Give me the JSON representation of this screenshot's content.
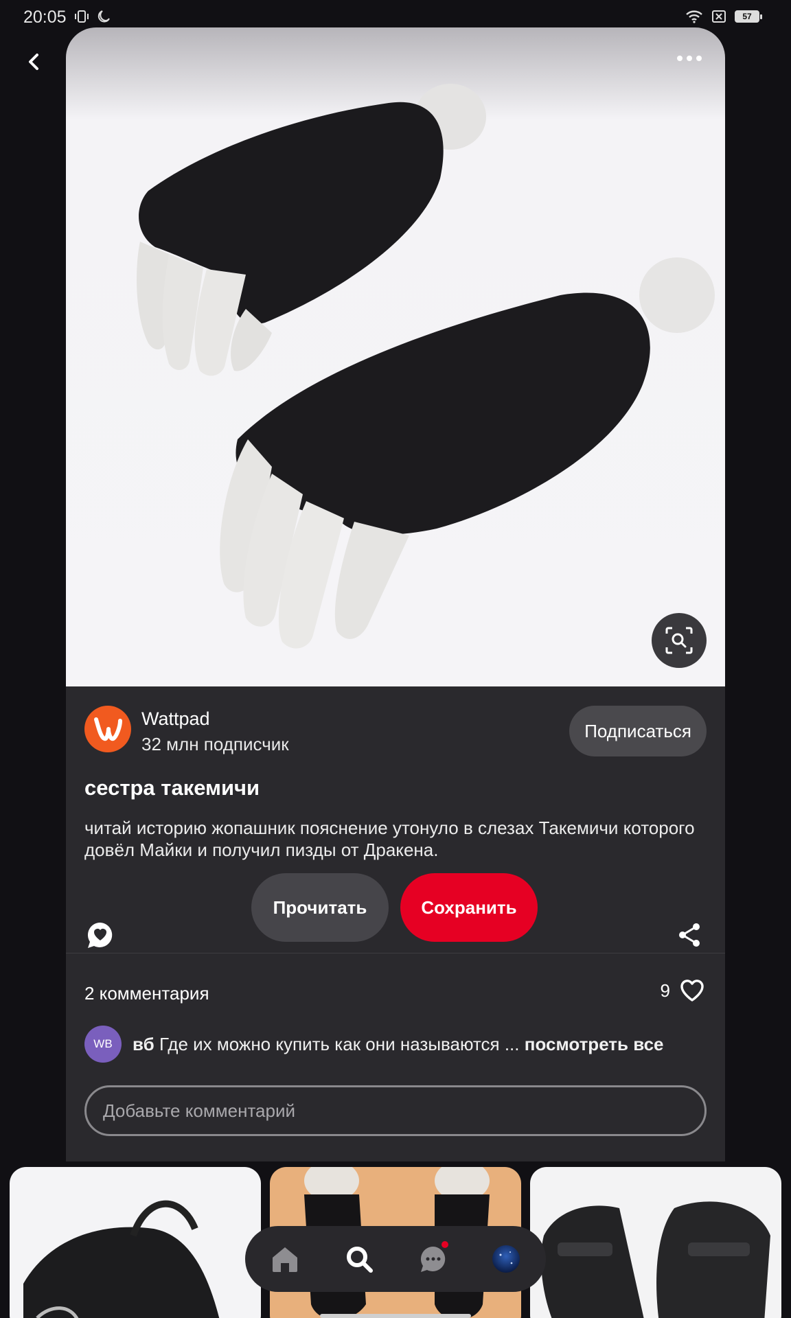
{
  "status_bar": {
    "time": "20:05",
    "battery": "57",
    "icons": [
      "vibrate-icon",
      "moon-icon",
      "wifi-icon",
      "sim-x-icon",
      "battery-icon"
    ]
  },
  "navigation": {
    "back_icon": "chevron-left-icon",
    "more_icon": "more-horizontal-icon"
  },
  "author": {
    "name": "Wattpad",
    "followers": "32 млн подписчик",
    "follow_label": "Подписаться",
    "avatar_letter": "w",
    "brand_color": "#f15a1f"
  },
  "pin": {
    "title": "сестра такемичи",
    "description": "читай историю жопашник пояснение утонуло в слезах Такемичи которого довёл Майки и получил пизды от Дракена."
  },
  "actions": {
    "read_label": "Прочитать",
    "save_label": "Сохранить",
    "save_color": "#e60023"
  },
  "comments": {
    "count_label": "2 комментария",
    "likes": "9",
    "preview": {
      "avatar_text": "WB",
      "user": "вб",
      "text": "Где их можно купить как они называются ...",
      "see_all": "посмотреть все"
    },
    "input_placeholder": "Добавьте комментарий"
  },
  "bottom_nav": {
    "items": [
      "home-icon",
      "search-icon",
      "messages-icon",
      "profile-avatar"
    ],
    "active": "search-icon",
    "notification_dot": "messages-icon"
  }
}
